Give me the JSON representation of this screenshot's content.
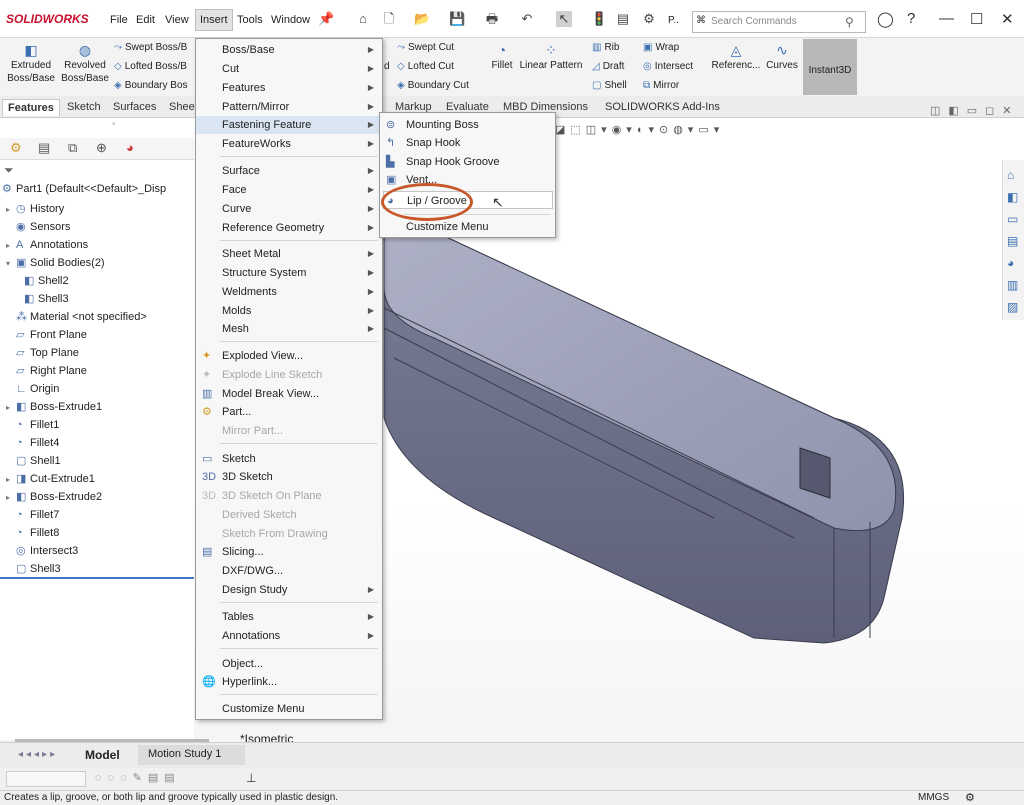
{
  "app": {
    "logo": "SOLIDWORKS"
  },
  "menubar": [
    "File",
    "Edit",
    "View",
    "Insert",
    "Tools",
    "Window"
  ],
  "search": {
    "placeholder": "Search Commands",
    "truncated_label": "P.."
  },
  "cmd": {
    "extruded": "Extruded Boss/Base",
    "revolved": "Revolved Boss/Base",
    "swept_boss": "Swept Boss/B",
    "lofted_boss": "Lofted Boss/B",
    "boundary_boss": "Boundary Bos",
    "swept_cut": "Swept Cut",
    "lofted_cut": "Lofted Cut",
    "boundary_cut": "Boundary Cut",
    "fillet": "Fillet",
    "linear_pattern": "Linear Pattern",
    "rib": "Rib",
    "draft": "Draft",
    "shell": "Shell",
    "wrap": "Wrap",
    "intersect": "Intersect",
    "mirror": "Mirror",
    "reference": "Referenc...",
    "curves": "Curves",
    "instant3d": "Instant3D",
    "partial_d": "d"
  },
  "tabs": [
    "Features",
    "Sketch",
    "Surfaces",
    "Shee",
    "Markup",
    "Evaluate",
    "MBD Dimensions",
    "SOLIDWORKS Add-Ins"
  ],
  "tree": [
    {
      "label": "Part1  (Default<<Default>_Disp",
      "icon": "part-icon"
    },
    {
      "label": "History",
      "icon": "history-icon"
    },
    {
      "label": "Sensors",
      "icon": "sensor-icon"
    },
    {
      "label": "Annotations",
      "icon": "annotation-icon"
    },
    {
      "label": "Solid Bodies(2)",
      "icon": "solid-bodies-icon"
    },
    {
      "label": "Shell2",
      "icon": "body-icon"
    },
    {
      "label": "Shell3",
      "icon": "body-icon"
    },
    {
      "label": "Material <not specified>",
      "icon": "material-icon"
    },
    {
      "label": "Front Plane",
      "icon": "plane-icon"
    },
    {
      "label": "Top Plane",
      "icon": "plane-icon"
    },
    {
      "label": "Right Plane",
      "icon": "plane-icon"
    },
    {
      "label": "Origin",
      "icon": "origin-icon"
    },
    {
      "label": "Boss-Extrude1",
      "icon": "extrude-icon"
    },
    {
      "label": "Fillet1",
      "icon": "fillet-icon"
    },
    {
      "label": "Fillet4",
      "icon": "fillet-icon"
    },
    {
      "label": "Shell1",
      "icon": "shell-icon"
    },
    {
      "label": "Cut-Extrude1",
      "icon": "cut-icon"
    },
    {
      "label": "Boss-Extrude2",
      "icon": "extrude-icon"
    },
    {
      "label": "Fillet7",
      "icon": "fillet-icon"
    },
    {
      "label": "Fillet8",
      "icon": "fillet-icon"
    },
    {
      "label": "Intersect3",
      "icon": "intersect-icon"
    },
    {
      "label": "Shell3",
      "icon": "shell-icon"
    }
  ],
  "insert_menu": [
    {
      "label": "Boss/Base",
      "sub": true
    },
    {
      "label": "Cut",
      "sub": true
    },
    {
      "label": "Features",
      "sub": true
    },
    {
      "label": "Pattern/Mirror",
      "sub": true
    },
    {
      "label": "Fastening Feature",
      "sub": true
    },
    {
      "label": "FeatureWorks",
      "sub": true
    },
    {
      "label": "Surface",
      "sub": true
    },
    {
      "label": "Face",
      "sub": true
    },
    {
      "label": "Curve",
      "sub": true
    },
    {
      "label": "Reference Geometry",
      "sub": true
    },
    {
      "label": "Sheet Metal",
      "sub": true
    },
    {
      "label": "Structure System",
      "sub": true
    },
    {
      "label": "Weldments",
      "sub": true
    },
    {
      "label": "Molds",
      "sub": true
    },
    {
      "label": "Mesh",
      "sub": true
    },
    {
      "label": "Exploded View..."
    },
    {
      "label": "Explode Line Sketch"
    },
    {
      "label": "Model Break View..."
    },
    {
      "label": "Part..."
    },
    {
      "label": "Mirror Part..."
    },
    {
      "label": "Sketch"
    },
    {
      "label": "3D Sketch"
    },
    {
      "label": "3D Sketch On Plane"
    },
    {
      "label": "Derived Sketch"
    },
    {
      "label": "Sketch From Drawing"
    },
    {
      "label": "Slicing..."
    },
    {
      "label": "DXF/DWG..."
    },
    {
      "label": "Design Study",
      "sub": true
    },
    {
      "label": "Tables",
      "sub": true
    },
    {
      "label": "Annotations",
      "sub": true
    },
    {
      "label": "Object..."
    },
    {
      "label": "Hyperlink..."
    },
    {
      "label": "Customize Menu"
    }
  ],
  "fastening_menu": [
    {
      "label": "Mounting Boss"
    },
    {
      "label": "Snap Hook"
    },
    {
      "label": "Snap Hook Groove"
    },
    {
      "label": "Vent..."
    },
    {
      "label": "Lip / Groove"
    },
    {
      "label": "Customize Menu"
    }
  ],
  "view_label": "*Isometric",
  "bottom_tabs": [
    "Model",
    "Motion Study 1"
  ],
  "status": {
    "message": "Creates a lip, groove, or both lip and groove typically used in plastic design.",
    "units": "MMGS"
  }
}
